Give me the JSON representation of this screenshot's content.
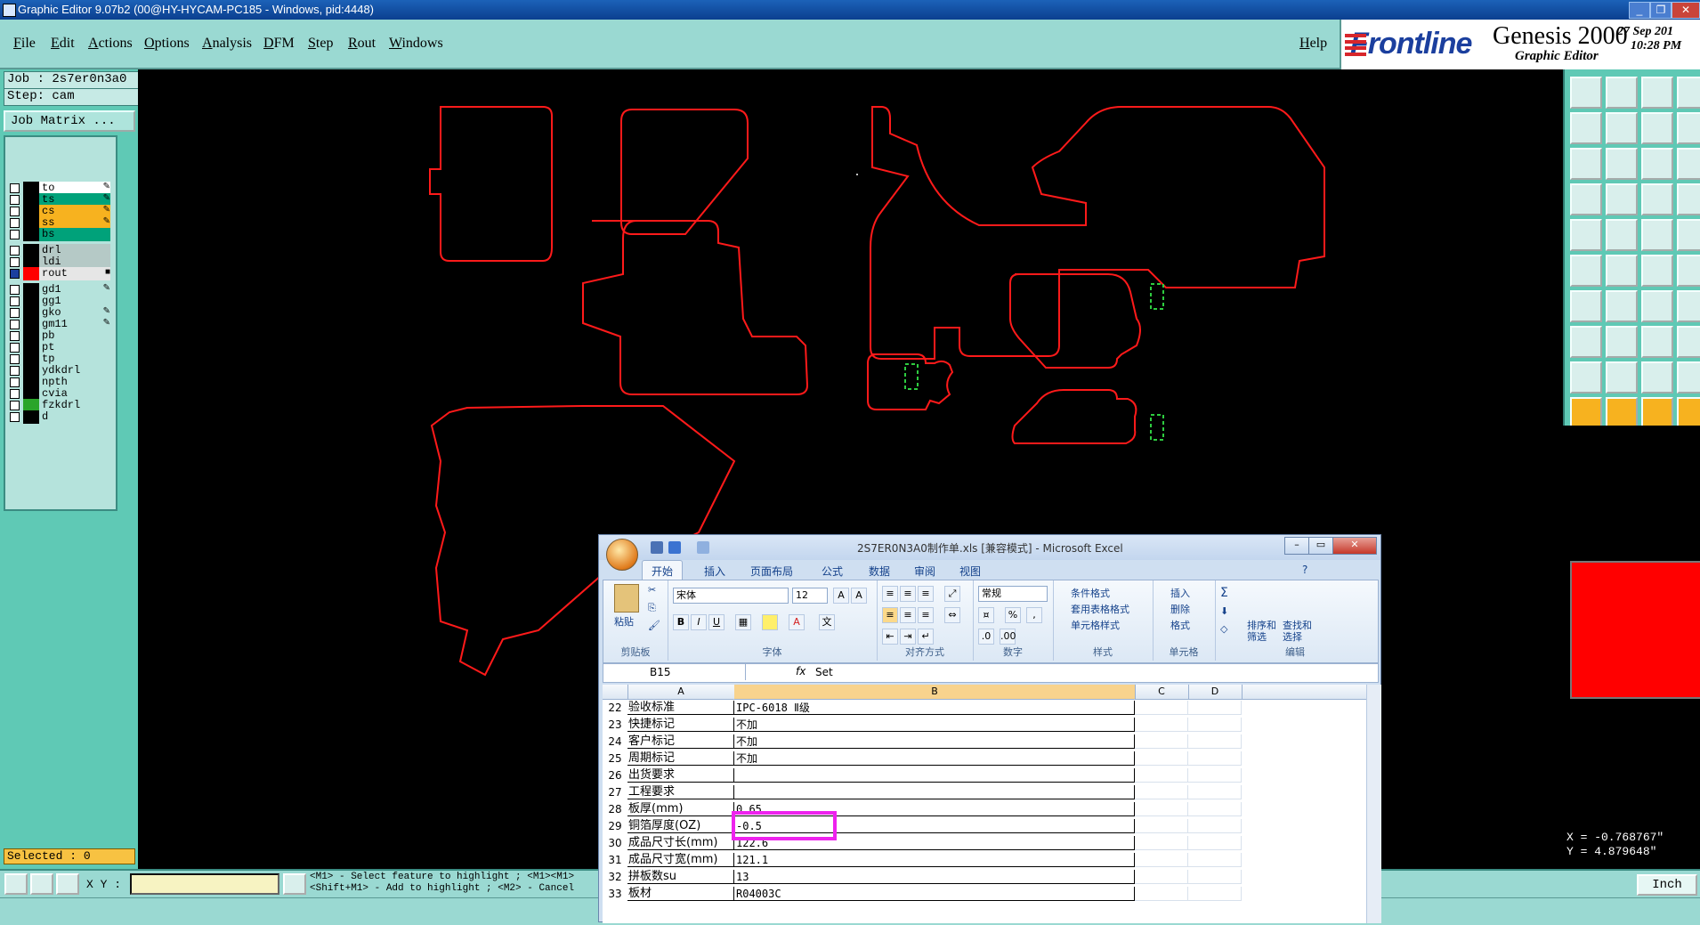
{
  "window": {
    "title": "Graphic Editor 9.07b2 (00@HY-HYCAM-PC185 - Windows, pid:4448)"
  },
  "menu": [
    "File",
    "Edit",
    "Actions",
    "Options",
    "Analysis",
    "DFM",
    "Step",
    "Rout",
    "Windows"
  ],
  "help_label": "Help",
  "logo": {
    "brand": "Frontline",
    "product": "Genesis 2000",
    "subtitle": "Graphic Editor",
    "date": "27 Sep 201",
    "time": "10:28 PM"
  },
  "left": {
    "job": "Job : 2s7er0n3a0",
    "step": "Step: cam",
    "job_matrix": "Job Matrix ...",
    "selected": "Selected : 0"
  },
  "layers": [
    {
      "name": "to",
      "color": "#ffffff",
      "mark": "✎"
    },
    {
      "name": "ts",
      "color": "#00a27a",
      "mark": "✎"
    },
    {
      "name": "cs",
      "color": "#f7b21f",
      "mark": "✎"
    },
    {
      "name": "ss",
      "color": "#f7b21f",
      "mark": "✎"
    },
    {
      "name": "bs",
      "color": "#00a27a",
      "mark": ""
    },
    {
      "name": "drl",
      "color": "#b5c9c6",
      "mark": ""
    },
    {
      "name": "ldi",
      "color": "#b5c9c6",
      "mark": ""
    },
    {
      "name": "rout",
      "color": "#e6e6e6",
      "mark": "■",
      "active": true,
      "swatch": "#ff0000"
    },
    {
      "name": "gd1",
      "color": "#b5e3dc",
      "mark": "✎"
    },
    {
      "name": "gg1",
      "color": "#b5e3dc",
      "mark": ""
    },
    {
      "name": "gko",
      "color": "#b5e3dc",
      "mark": "✎"
    },
    {
      "name": "gm11",
      "color": "#b5e3dc",
      "mark": "✎"
    },
    {
      "name": "pb",
      "color": "#b5e3dc",
      "mark": ""
    },
    {
      "name": "pt",
      "color": "#b5e3dc",
      "mark": ""
    },
    {
      "name": "tp",
      "color": "#b5e3dc",
      "mark": ""
    },
    {
      "name": "ydkdrl",
      "color": "#b5e3dc",
      "mark": ""
    },
    {
      "name": "npth",
      "color": "#b5e3dc",
      "mark": ""
    },
    {
      "name": "cvia",
      "color": "#b5e3dc",
      "mark": ""
    },
    {
      "name": "fzkdrl",
      "color": "#b5e3dc",
      "mark": "",
      "swatch": "#2aa52a"
    },
    {
      "name": "d",
      "color": "#b5e3dc",
      "mark": ""
    }
  ],
  "coords": {
    "x": "X = -0.768767\"",
    "y": "Y = 4.879648\""
  },
  "bottom": {
    "xy_label": "X Y :",
    "xy_value": "",
    "hint_line1": "<M1> - Select feature to highlight ; <M1><M1>",
    "hint_line2": "<Shift+M1> - Add to highlight ; <M2> - Cancel",
    "unit": "Inch"
  },
  "excel": {
    "title": "2S7ER0N3A0制作单.xls  [兼容模式] - Microsoft Excel",
    "tabs": [
      "开始",
      "插入",
      "页面布局",
      "公式",
      "数据",
      "审阅",
      "视图"
    ],
    "ribbon": {
      "paste": "粘贴",
      "clipboard": "剪贴板",
      "font_name": "宋体",
      "font_size": "12",
      "font_group": "字体",
      "align_group": "对齐方式",
      "number_format": "常规",
      "number_group": "数字",
      "conditional": "条件格式",
      "table_format": "套用表格格式",
      "cell_style": "单元格样式",
      "style_group": "样式",
      "insert": "插入",
      "delete": "删除",
      "format": "格式",
      "cells_group": "单元格",
      "sort": "排序和\n筛选",
      "find": "查找和\n选择",
      "edit_group": "编辑"
    },
    "name_box": "B15",
    "fx": "fx",
    "formula": "Set",
    "columns": [
      "A",
      "B",
      "C",
      "D"
    ],
    "rows": [
      {
        "n": "22",
        "a": "验收标准",
        "b": "IPC-6018 Ⅱ级"
      },
      {
        "n": "23",
        "a": "快捷标记",
        "b": "不加"
      },
      {
        "n": "24",
        "a": "客户标记",
        "b": "不加"
      },
      {
        "n": "25",
        "a": "周期标记",
        "b": "不加"
      },
      {
        "n": "26",
        "a": "出货要求",
        "b": ""
      },
      {
        "n": "27",
        "a": "工程要求",
        "b": ""
      },
      {
        "n": "28",
        "a": "板厚(mm)",
        "b": "0.65"
      },
      {
        "n": "29",
        "a": "铜箔厚度(OZ)",
        "b": "-0.5"
      },
      {
        "n": "30",
        "a": "成品尺寸长(mm)",
        "b": "122.6"
      },
      {
        "n": "31",
        "a": "成品尺寸宽(mm)",
        "b": "121.1"
      },
      {
        "n": "32",
        "a": "拼板数su",
        "b": "13"
      },
      {
        "n": "33",
        "a": "板材",
        "b": "R04003C"
      }
    ]
  }
}
